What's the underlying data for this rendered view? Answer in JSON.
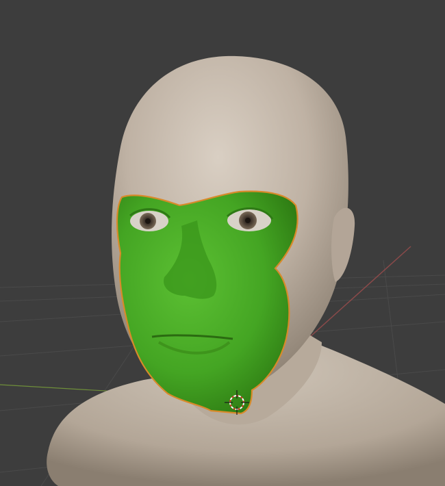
{
  "viewport": {
    "background": "#3d3d3d",
    "grid_color": "#4a4a4a",
    "x_axis_color": "#8a4a4a",
    "y_axis_color": "#6f8f3a"
  },
  "scene": {
    "head_mesh": {
      "color": "#c0b4a6",
      "shadow": "#8f8376"
    },
    "face_mask": {
      "color": "#4fb02a",
      "shadow": "#2f7a16",
      "outline": "#d88a2a",
      "selected": true
    },
    "eyes": {
      "iris": "#6a5a4a",
      "sclera": "#d8d2c8"
    }
  },
  "cursor_3d": {
    "icon": "3d-cursor-icon",
    "ring_color": "#ffffff",
    "dash_color": "#d83a2a"
  }
}
